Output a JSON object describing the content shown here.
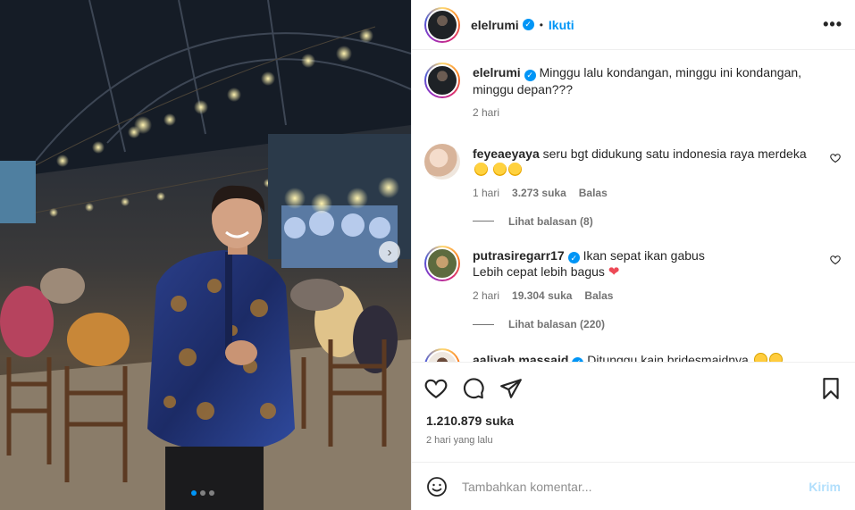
{
  "post": {
    "author": "elelrumi",
    "follow_label": "Ikuti",
    "separator": "•",
    "caption": "Minggu lalu kondangan, minggu ini kondangan, minggu depan???",
    "caption_time": "2 hari",
    "likes": "1.210.879 suka",
    "posted_ago": "2 hari yang lalu",
    "carousel": {
      "total": 3,
      "current": 1
    }
  },
  "comments": [
    {
      "user": "feyeaeyaya",
      "verified": false,
      "text": "seru bgt didukung satu indonesia raya merdeka",
      "emojis": [
        "crying-face",
        "crying-face",
        "crying-face"
      ],
      "time": "1 hari",
      "likes": "3.273 suka",
      "reply": "Balas",
      "view_replies": "Lihat balasan (8)"
    },
    {
      "user": "putrasiregarr17",
      "verified": true,
      "text": "Ikan sepat ikan gabus",
      "text2": "Lebih cepat lebih bagus",
      "emojis": [
        "red-heart"
      ],
      "time": "2 hari",
      "likes": "19.304 suka",
      "reply": "Balas",
      "view_replies": "Lihat balasan (220)"
    },
    {
      "user": "aaliyah.massaid",
      "verified": true,
      "text": "Ditunggu kain bridesmaidnya",
      "emojis": [
        "smiling-face",
        "smiling-face"
      ]
    }
  ],
  "composer": {
    "placeholder": "Tambahkan komentar...",
    "submit_label": "Kirim"
  },
  "icons": {
    "like": "heart-icon",
    "comment": "comment-icon",
    "share": "share-icon",
    "save": "bookmark-icon",
    "more": "more-options-icon",
    "emoji": "emoji-icon"
  },
  "colors": {
    "accent": "#0095f6",
    "muted": "#737373",
    "border": "#efefef",
    "like_red": "#ed4956",
    "post_disabled": "#b2dffc"
  }
}
